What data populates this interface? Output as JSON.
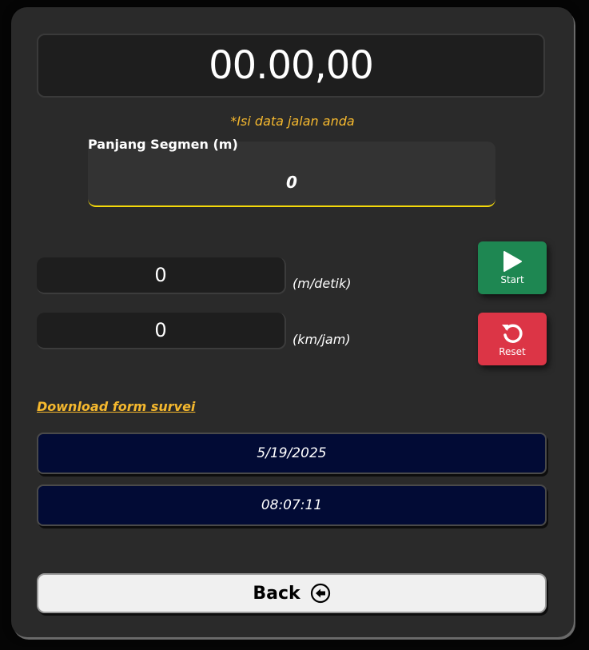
{
  "timer": {
    "display": "00.00,00"
  },
  "hint": {
    "text": "*Isi data jalan anda"
  },
  "segmen": {
    "label": "Panjang Segmen (m)",
    "value": "0"
  },
  "speed_ms": {
    "value": "0",
    "unit": "(m/detik)"
  },
  "speed_kmh": {
    "value": "0",
    "unit": "(km/jam)"
  },
  "controls": {
    "start_label": "Start",
    "start_icon": "play-icon",
    "start_color": "#1e8752",
    "reset_label": "Reset",
    "reset_icon": "reset-icon",
    "reset_color": "#dc3546"
  },
  "download": {
    "label": "Download form survei"
  },
  "datetime": {
    "date": "5/19/2025",
    "time": "08:07:11"
  },
  "back": {
    "label": "Back",
    "icon": "arrow-left-circle-icon"
  },
  "colors": {
    "accent_yellow": "#f5b82e",
    "date_bg": "#020b35",
    "card_bg": "#2a2a2a"
  }
}
